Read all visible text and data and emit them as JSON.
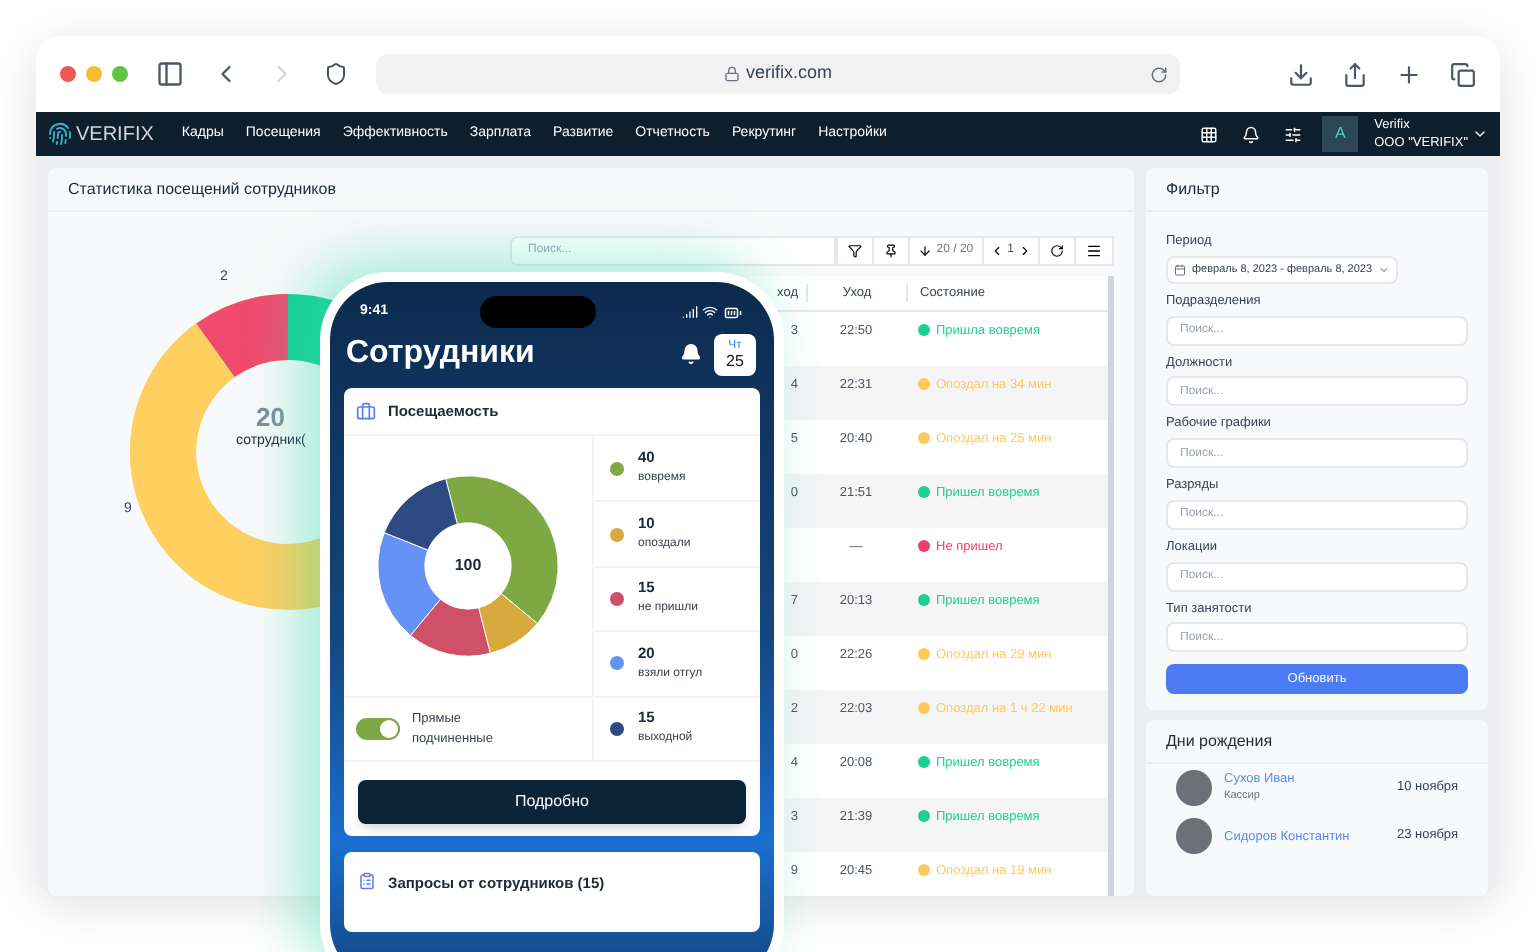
{
  "browser": {
    "address": "verifix.com"
  },
  "nav": {
    "logo": "VERIFIX",
    "items": [
      "Кадры",
      "Посещения",
      "Эффективность",
      "Зарплата",
      "Развитие",
      "Отчетность",
      "Рекрутинг",
      "Настройки"
    ],
    "avatar": "A",
    "account_name": "Verifix",
    "account_org": "ООО \"VERIFIX\""
  },
  "stats_panel": {
    "title": "Статистика посещений сотрудников",
    "donut": {
      "center_value": "20",
      "center_label": "сотрудник(",
      "slice_labels": [
        "2",
        "9"
      ]
    }
  },
  "table": {
    "search_placeholder": "Поиск...",
    "count": "20 / 20",
    "page": "1",
    "columns": [
      "ход",
      "Уход",
      "Состояние"
    ],
    "rows": [
      {
        "column_1": "3",
        "leave": "22:50",
        "status": "Пришла вовремя",
        "color": "#1fcf8f"
      },
      {
        "column_1": "4",
        "leave": "22:31",
        "status": "Опоздал на 34 мин",
        "color": "#ffc95c"
      },
      {
        "column_1": "5",
        "leave": "20:40",
        "status": "Опоздал на 25 мин",
        "color": "#ffc95c"
      },
      {
        "column_1": "0",
        "leave": "21:51",
        "status": "Пришел вовремя",
        "color": "#1fcf8f"
      },
      {
        "column_1": "",
        "leave": "—",
        "status": "Не пришел",
        "color": "#f0406a"
      },
      {
        "column_1": "7",
        "leave": "20:13",
        "status": "Пришел вовремя",
        "color": "#1fcf8f"
      },
      {
        "column_1": "0",
        "leave": "22:26",
        "status": "Опоздал на 29 мин",
        "color": "#ffc95c"
      },
      {
        "column_1": "2",
        "leave": "22:03",
        "status": "Опоздал на 1 ч 22 мин",
        "color": "#ffc95c"
      },
      {
        "column_1": "4",
        "leave": "20:08",
        "status": "Пришел вовремя",
        "color": "#1fcf8f"
      },
      {
        "column_1": "3",
        "leave": "21:39",
        "status": "Пришел вовремя",
        "color": "#1fcf8f"
      },
      {
        "column_1": "9",
        "leave": "20:45",
        "status": "Опоздал на 19 мин",
        "color": "#ffc95c"
      }
    ]
  },
  "filter": {
    "title": "Фильтр",
    "period_label": "Период",
    "period_value": "февраль 8, 2023 - февраль 8, 2023",
    "fields": [
      {
        "label": "Подразделения",
        "placeholder": "Поиск..."
      },
      {
        "label": "Должности",
        "placeholder": "Поиск..."
      },
      {
        "label": "Рабочие графики",
        "placeholder": "Поиск..."
      },
      {
        "label": "Разряды",
        "placeholder": "Поиск..."
      },
      {
        "label": "Локации",
        "placeholder": "Поиск..."
      },
      {
        "label": "Тип занятости",
        "placeholder": "Поиск..."
      }
    ],
    "button": "Обновить"
  },
  "birthdays": {
    "title": "Дни рождения",
    "people": [
      {
        "name": "Сухов Иван",
        "role": "Кассир",
        "date": "10 ноября"
      },
      {
        "name": "Сидоров Константин",
        "date": "23 ноября"
      }
    ]
  },
  "phone": {
    "time": "9:41",
    "title": "Сотрудники",
    "day": "Чт",
    "date": "25",
    "attendance": {
      "title": "Посещаемость",
      "center": "100",
      "legend": [
        {
          "value": "40",
          "label": "вовремя",
          "color": "#7ea844"
        },
        {
          "value": "10",
          "label": "опоздали",
          "color": "#d8aa3e"
        },
        {
          "value": "15",
          "label": "не пришли",
          "color": "#cf5067"
        },
        {
          "value": "20",
          "label": "взяли отгул",
          "color": "#6493f5"
        },
        {
          "value": "15",
          "label": "выходной",
          "color": "#2c4b82"
        }
      ],
      "chart_data": {
        "type": "donut",
        "values": [
          40,
          10,
          15,
          20,
          15
        ]
      },
      "toggle": {
        "label": "Прямые подчиненные",
        "on": true
      },
      "button": "Подробно"
    },
    "requests": {
      "title": "Запросы от сотрудников (15)"
    }
  }
}
